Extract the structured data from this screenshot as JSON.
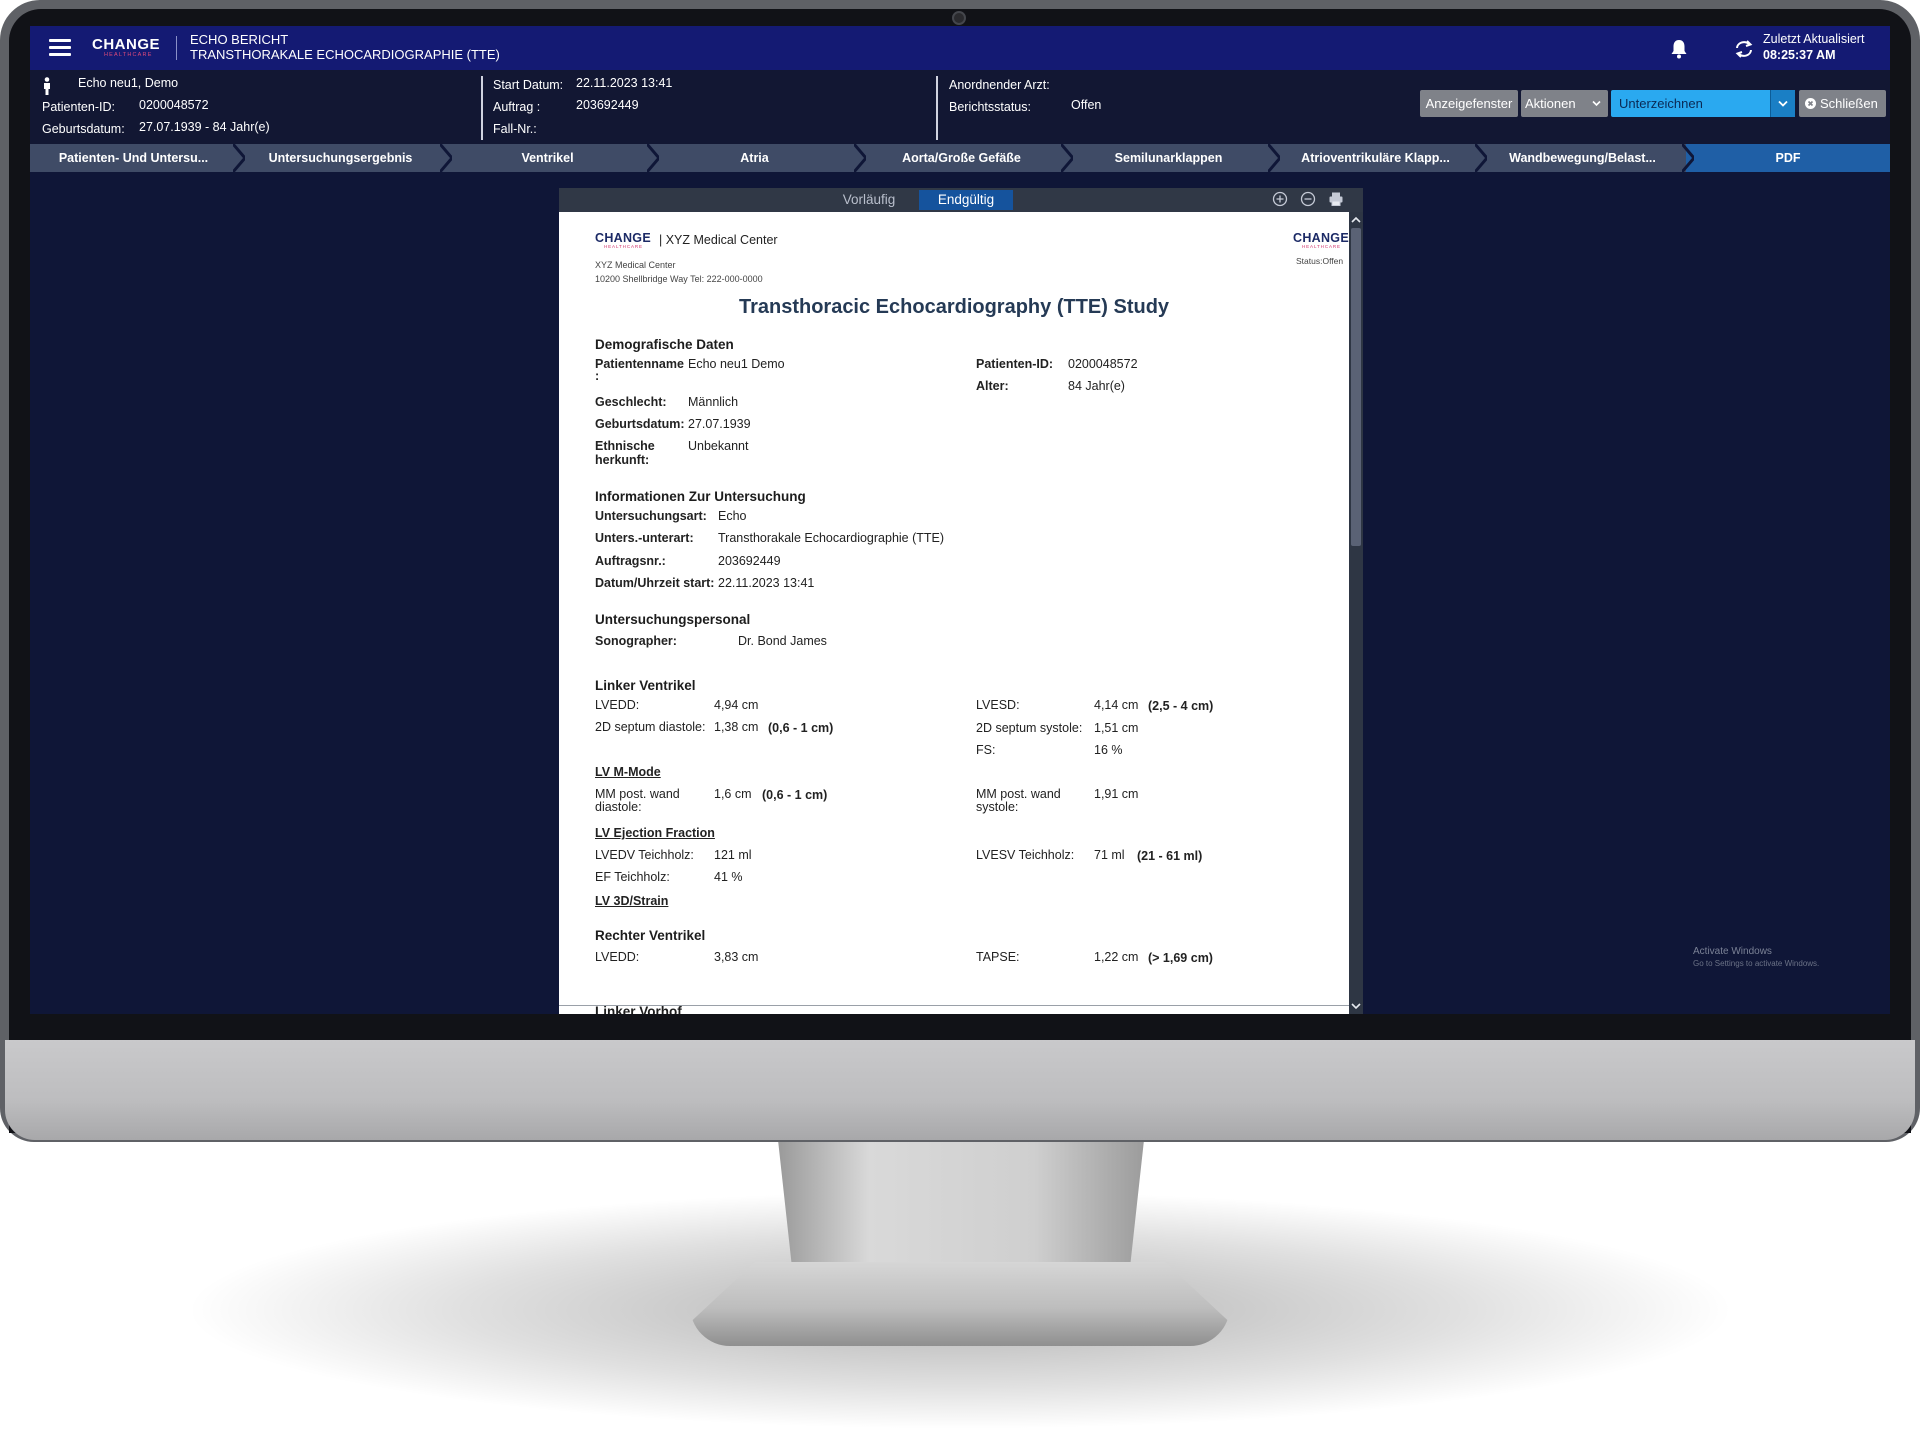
{
  "app": {
    "brand_name": "CHANGE",
    "brand_sub": "HEALTHCARE",
    "title_line1": "ECHO BERICHT",
    "title_line2": "TRANSTHORAKALE ECHOCARDIOGRAPHIE (TTE)",
    "last_update_label": "Zuletzt Aktualisiert",
    "last_update_time": "08:25:37 AM"
  },
  "patient": {
    "name": "Echo neu1, Demo",
    "id_label": "Patienten-ID:",
    "id_value": "0200048572",
    "dob_label": "Geburtsdatum:",
    "dob_value": "27.07.1939 - 84 Jahr(e)"
  },
  "order": {
    "start_label": "Start Datum:",
    "start_value": "22.11.2023 13:41",
    "order_label": "Auftrag :",
    "order_value": "203692449",
    "case_label": "Fall-Nr.:",
    "case_value": ""
  },
  "report": {
    "physician_label": "Anordnender Arzt:",
    "physician_value": "",
    "status_label": "Berichtsstatus:",
    "status_value": "Offen"
  },
  "actions": {
    "viewer_btn": "Anzeigefenster",
    "actions_btn": "Aktionen",
    "sign_btn": "Unterzeichnen",
    "close_btn": "Schließen"
  },
  "steps": [
    "Patienten- Und Untersu...",
    "Untersuchungsergebnis",
    "Ventrikel",
    "Atria",
    "Aorta/Große Gefäße",
    "Semilunarklappen",
    "Atrioventrikuläre Klapp...",
    "Wandbewegung/Belast...",
    "PDF"
  ],
  "viewer": {
    "tab_preliminary": "Vorläufig",
    "tab_final": "Endgültig",
    "icons": [
      "zoom-in-icon",
      "zoom-out-icon",
      "print-icon"
    ]
  },
  "doc": {
    "brand_name": "CHANGE",
    "brand_sub": "HEALTHCARE",
    "center_heading": "| XYZ Medical Center",
    "center_name": "XYZ Medical Center",
    "center_address": "10200 Shellbridge Way Tel: 222-000-0000",
    "status_right": "Status:Offen",
    "title": "Transthoracic Echocardiography (TTE) Study",
    "demo": {
      "heading": "Demografische Daten",
      "name_label": "Patientenname",
      "name_colon": ":",
      "name_value": "Echo neu1 Demo",
      "sex_label": "Geschlecht:",
      "sex_value": "Männlich",
      "dob_label": "Geburtsdatum:",
      "dob_value": "27.07.1939",
      "eth_label1": "Ethnische",
      "eth_label2": "herkunft:",
      "eth_value": "Unbekannt",
      "pid_label": "Patienten-ID:",
      "pid_value": "0200048572",
      "age_label": "Alter:",
      "age_value": "84 Jahr(e)"
    },
    "exam": {
      "heading": "Informationen Zur Untersuchung",
      "type_label": "Untersuchungsart:",
      "type_value": "Echo",
      "subtype_label": "Unters.-unterart:",
      "subtype_value": "Transthorakale Echocardiographie (TTE)",
      "order_label": "Auftragsnr.:",
      "order_value": "203692449",
      "start_label": "Datum/Uhrzeit start:",
      "start_value": "22.11.2023 13:41"
    },
    "staff": {
      "heading": "Untersuchungspersonal",
      "sono_label": "Sonographer:",
      "sono_value": "Dr. Bond James"
    },
    "lv": {
      "heading": "Linker Ventrikel",
      "lvedd_label": "LVEDD:",
      "lvedd_value": "4,94 cm",
      "sept_d_label": "2D septum diastole:",
      "sept_d_value": "1,38 cm",
      "sept_d_range": "(0,6 - 1 cm)",
      "lvesd_label": "LVESD:",
      "lvesd_value": "4,14 cm",
      "lvesd_range": "(2,5 - 4 cm)",
      "sept_s_label": "2D septum systole:",
      "sept_s_value": "1,51 cm",
      "fs_label": "FS:",
      "fs_value": "16 %",
      "mmode_heading": "LV M-Mode",
      "mm_d_label1": "MM post. wand",
      "mm_d_label2": "diastole:",
      "mm_d_value": "1,6 cm",
      "mm_d_range": "(0,6 - 1 cm)",
      "mm_s_label1": "MM post. wand",
      "mm_s_label2": "systole:",
      "mm_s_value": "1,91 cm",
      "ef_heading": "LV Ejection Fraction",
      "lvedv_label": "LVEDV Teichholz:",
      "lvedv_value": "121 ml",
      "ef_label": "EF Teichholz:",
      "ef_value": "41 %",
      "lvesv_label": "LVESV Teichholz:",
      "lvesv_value": "71 ml",
      "lvesv_range": "(21 - 61 ml)",
      "strain_heading": "LV 3D/Strain"
    },
    "rv": {
      "heading": "Rechter Ventrikel",
      "lvedd_label": "LVEDD:",
      "lvedd_value": "3,83 cm",
      "tapse_label": "TAPSE:",
      "tapse_value": "1,22 cm",
      "tapse_range": "(> 1,69 cm)"
    },
    "la": {
      "heading": "Linker Vorhof"
    }
  },
  "os_watermark": {
    "line1": "Activate Windows",
    "line2": "Go to Settings to activate Windows."
  },
  "colors": {
    "topbar": "#141a73",
    "background": "#0f1637",
    "active_step": "#1f5fa6",
    "sign_button": "#2aa9f0"
  }
}
